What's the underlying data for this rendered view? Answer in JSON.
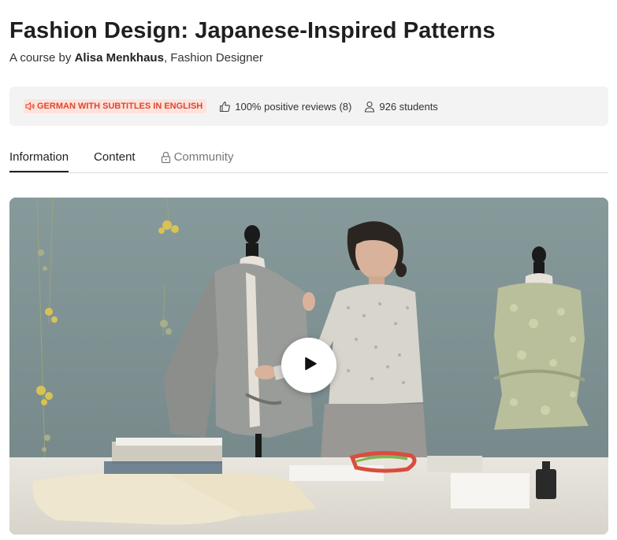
{
  "course": {
    "title": "Fashion Design: Japanese-Inspired Patterns",
    "byline_prefix": "A course by",
    "author": "Alisa Menkhaus",
    "author_role": ", Fashion Designer"
  },
  "info": {
    "language_badge": "GERMAN WITH SUBTITLES IN ENGLISH",
    "reviews": "100% positive reviews (8)",
    "students": "926 students"
  },
  "tabs": [
    {
      "label": "Information",
      "active": true
    },
    {
      "label": "Content",
      "active": false
    },
    {
      "label": "Community",
      "active": false,
      "locked": true
    }
  ],
  "video": {
    "play_icon": "play-icon"
  },
  "colors": {
    "badge_background": "#fde3dc",
    "badge_text": "#e0452f",
    "info_background": "#f3f3f3",
    "video_wall": "#7e9090"
  }
}
